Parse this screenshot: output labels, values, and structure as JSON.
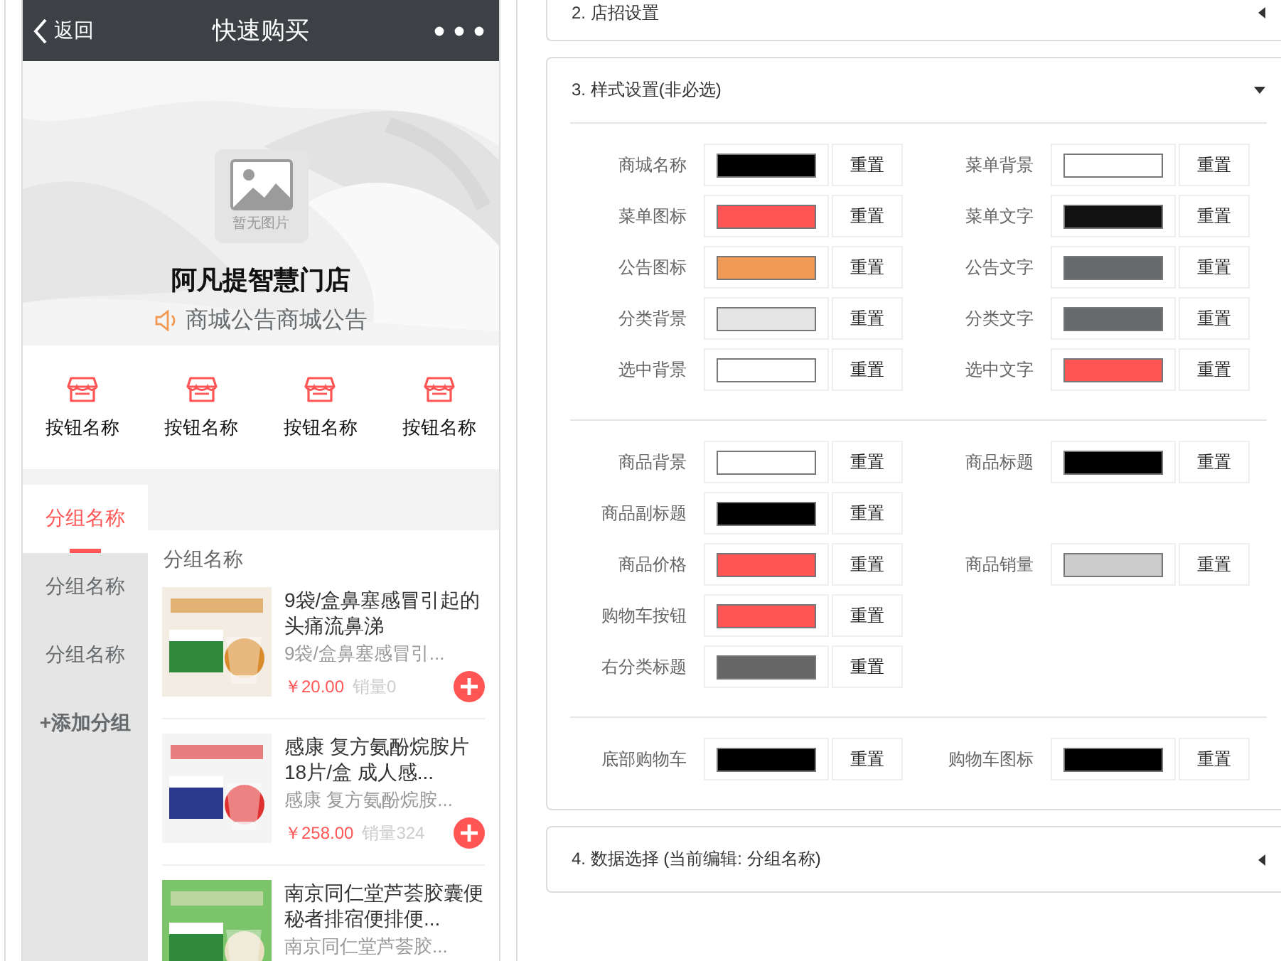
{
  "phone": {
    "header": {
      "back": "返回",
      "title": "快速购买"
    },
    "banner": {
      "placeholder": "暂无图片",
      "store_name": "阿凡提智慧门店",
      "notice": "商城公告商城公告"
    },
    "menu_buttons": [
      {
        "label": "按钮名称"
      },
      {
        "label": "按钮名称"
      },
      {
        "label": "按钮名称"
      },
      {
        "label": "按钮名称"
      }
    ],
    "categories": [
      {
        "label": "分组名称",
        "selected": true
      },
      {
        "label": "分组名称",
        "selected": false
      },
      {
        "label": "分组名称",
        "selected": false
      }
    ],
    "add_group": "+添加分组",
    "section_title": "分组名称",
    "products": [
      {
        "title": "9袋/盒鼻塞感冒引起的头痛流鼻涕",
        "subtitle": "9袋/盒鼻塞感冒引...",
        "price": "￥20.00",
        "sales": "销量0"
      },
      {
        "title": "感康 复方氨酚烷胺片18片/盒 成人感...",
        "subtitle": "感康 复方氨酚烷胺...",
        "price": "￥258.00",
        "sales": "销量324"
      },
      {
        "title": "南京同仁堂芦荟胶囊便秘者排宿便排便...",
        "subtitle": "南京同仁堂芦荟胶..."
      }
    ]
  },
  "panel": {
    "sections": [
      {
        "title": "2. 店招设置",
        "expanded": false
      },
      {
        "title": "3. 样式设置(非必选)",
        "expanded": true,
        "groups": [
          {
            "rows": [
              {
                "left": {
                  "label": "商城名称",
                  "color": "#000000",
                  "reset": "重置"
                },
                "right": {
                  "label": "菜单背景",
                  "color": "#ffffff",
                  "reset": "重置"
                }
              },
              {
                "left": {
                  "label": "菜单图标",
                  "color": "#ff5555",
                  "reset": "重置"
                },
                "right": {
                  "label": "菜单文字",
                  "color": "#111111",
                  "reset": "重置"
                }
              },
              {
                "left": {
                  "label": "公告图标",
                  "color": "#f09a56",
                  "reset": "重置"
                },
                "right": {
                  "label": "公告文字",
                  "color": "#666a6d",
                  "reset": "重置"
                }
              },
              {
                "left": {
                  "label": "分类背景",
                  "color": "#e5e5e5",
                  "reset": "重置"
                },
                "right": {
                  "label": "分类文字",
                  "color": "#666a6d",
                  "reset": "重置"
                }
              },
              {
                "left": {
                  "label": "选中背景",
                  "color": "#ffffff",
                  "reset": "重置"
                },
                "right": {
                  "label": "选中文字",
                  "color": "#ff5555",
                  "reset": "重置"
                }
              }
            ]
          },
          {
            "rows": [
              {
                "left": {
                  "label": "商品背景",
                  "color": "#ffffff",
                  "reset": "重置"
                },
                "right": {
                  "label": "商品标题",
                  "color": "#000000",
                  "reset": "重置"
                }
              },
              {
                "left": {
                  "label": "商品副标题",
                  "color": "#000000",
                  "reset": "重置"
                }
              },
              {
                "left": {
                  "label": "商品价格",
                  "color": "#ff5555",
                  "reset": "重置"
                },
                "right": {
                  "label": "商品销量",
                  "color": "#cccccc",
                  "reset": "重置"
                }
              },
              {
                "left": {
                  "label": "购物车按钮",
                  "color": "#ff5555",
                  "reset": "重置"
                }
              },
              {
                "left": {
                  "label": "右分类标题",
                  "color": "#666666",
                  "reset": "重置"
                }
              }
            ]
          },
          {
            "rows": [
              {
                "left": {
                  "label": "底部购物车",
                  "color": "#000000",
                  "reset": "重置"
                },
                "right": {
                  "label": "购物车图标",
                  "color": "#000000",
                  "reset": "重置"
                }
              }
            ]
          }
        ]
      },
      {
        "title": "4. 数据选择 (当前编辑: 分组名称)",
        "expanded": false
      }
    ]
  }
}
